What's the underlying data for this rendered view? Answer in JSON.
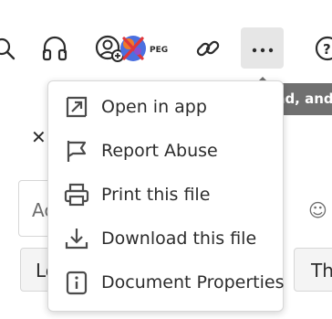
{
  "toolbar": {
    "icons": [
      "search-icon",
      "headphones-icon",
      "add-user-icon",
      "jpeg-app-icon",
      "link-icon",
      "more-options-icon",
      "help-icon"
    ],
    "app_badge_text": "PEG"
  },
  "tooltip": {
    "text": "Print, download, and more"
  },
  "background": {
    "field_a_text": "Ac",
    "field_b_text": "Lo",
    "field_c_text": "Tha"
  },
  "menu": {
    "items": [
      {
        "label": "Open in app",
        "icon": "open-in-icon"
      },
      {
        "label": "Report Abuse",
        "icon": "flag-icon"
      },
      {
        "label": "Print this file",
        "icon": "printer-icon"
      },
      {
        "label": "Download this file",
        "icon": "download-icon"
      },
      {
        "label": "Document Properties",
        "icon": "info-icon"
      }
    ]
  },
  "colors": {
    "tooltip_bg": "#707070",
    "selected_button_bg": "#e6e6e6",
    "text": "#2c2c2c"
  }
}
